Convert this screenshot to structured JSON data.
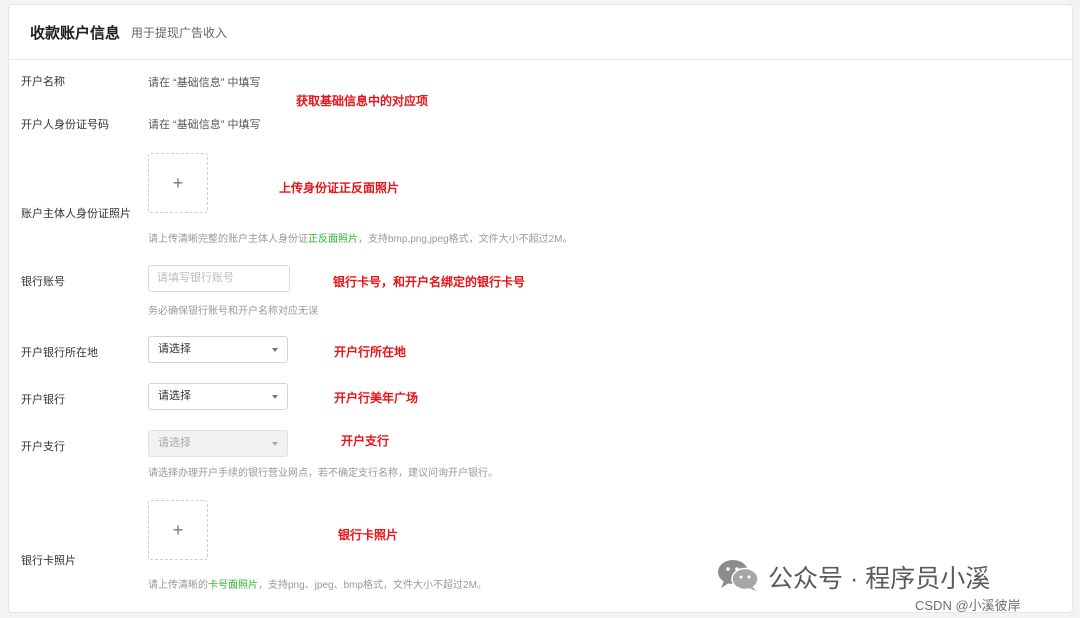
{
  "header": {
    "title": "收款账户信息",
    "subtitle": "用于提现广告收入"
  },
  "rows": {
    "account_name": {
      "label": "开户名称",
      "value": "请在 “基础信息” 中填写"
    },
    "id_number": {
      "label": "开户人身份证号码",
      "value": "请在 “基础信息” 中填写"
    },
    "id_photo": {
      "label": "账户主体人身份证照片",
      "hint_before": "请上传清晰完整的账户主体人身份证",
      "hint_highlight": "正反面照片",
      "hint_after": "，支持bmp,png,jpeg格式，文件大小不超过2M。"
    },
    "bank_account": {
      "label": "银行账号",
      "placeholder": "请填写银行账号",
      "hint": "务必确保银行账号和开户名称对应无误"
    },
    "bank_location": {
      "label": "开户银行所在地",
      "selected": "请选择"
    },
    "bank": {
      "label": "开户银行",
      "selected": "请选择"
    },
    "branch": {
      "label": "开户支行",
      "selected": "请选择",
      "hint": "请选择办理开户手续的银行营业网点，若不确定支行名称，建议问询开户银行。"
    },
    "card_photo": {
      "label": "银行卡照片",
      "hint_before": "请上传清晰的",
      "hint_highlight": "卡号面照片",
      "hint_after": "，支持png、jpeg、bmp格式，文件大小不超过2M。"
    }
  },
  "upload_plus": "+",
  "annotations": {
    "basic_info": "获取基础信息中的对应项",
    "id_photo": "上传身份证正反面照片",
    "bank_account": "银行卡号，和开户名绑定的银行卡号",
    "bank_location": "开户行所在地",
    "bank": "开户行美年广场",
    "branch": "开户支行",
    "card_photo": "银行卡照片"
  },
  "watermark": {
    "text": "公众号 · 程序员小溪",
    "icon": "wechat-icon"
  },
  "credit": "CSDN @小溪彼岸",
  "colors": {
    "highlight_green": "#2eb82e",
    "annotation_red": "#e8141a"
  }
}
